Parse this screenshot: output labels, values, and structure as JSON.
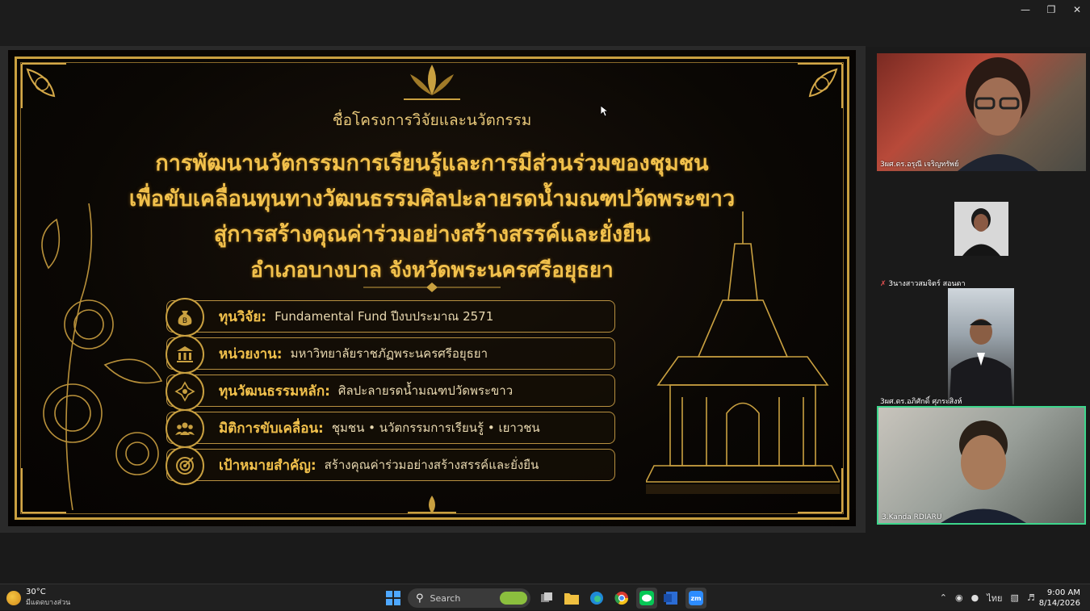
{
  "window": {
    "minimize_icon": "minimize-icon",
    "restore_icon": "restore-icon",
    "close_icon": "close-icon"
  },
  "slide": {
    "heading": "ชื่อโครงการวิจัยและนวัตกรรม",
    "title_lines": [
      "การพัฒนานวัตกรรมการเรียนรู้และการมีส่วนร่วมของชุมชน",
      "เพื่อขับเคลื่อนทุนทางวัฒนธรรมศิลปะลายรดน้ำมณฑปวัดพระขาว",
      "สู่การสร้างคุณค่าร่วมอย่างสร้างสรรค์และยั่งยืน",
      "อำเภอบางบาล จังหวัดพระนครศรีอยุธยา"
    ],
    "info": [
      {
        "label": "ทุนวิจัย:",
        "value": "Fundamental Fund ปีงบประมาณ 2571",
        "icon": "money-bag-icon"
      },
      {
        "label": "หน่วยงาน:",
        "value": "มหาวิทยาลัยราชภัฏพระนครศรีอยุธยา",
        "icon": "institution-icon"
      },
      {
        "label": "ทุนวัฒนธรรมหลัก:",
        "value": "ศิลปะลายรดน้ำมณฑปวัดพระขาว",
        "icon": "lotus-ornament-icon"
      },
      {
        "label": "มิติการขับเคลื่อน:",
        "value": "ชุมชน • นวัตกรรมการเรียนรู้ • เยาวชน",
        "icon": "people-group-icon"
      },
      {
        "label": "เป้าหมายสำคัญ:",
        "value": "สร้างคุณค่าร่วมอย่างสร้างสรรค์และยั่งยืน",
        "icon": "target-icon"
      }
    ]
  },
  "participants": [
    {
      "name": "3ผศ.ดร.อรุณี เจริญทรัพย์"
    },
    {
      "name": "3นางสาวสมจิตร์ สอนดา"
    },
    {
      "name": "3ผศ.ดร.อภิศักดิ์ ศุภระสิงห์"
    },
    {
      "name": "3.Kanda RDIARU"
    }
  ],
  "taskbar": {
    "weather_temp": "30°C",
    "weather_desc": "มีแดดบางส่วน",
    "search_placeholder": "Search",
    "tray_lang": "ไทย",
    "time": "9:00 AM",
    "date": "8/14/2026",
    "zoom_label": "zm"
  },
  "colors": {
    "gold": "#f2c14c",
    "active_speaker": "#3dd68c"
  }
}
